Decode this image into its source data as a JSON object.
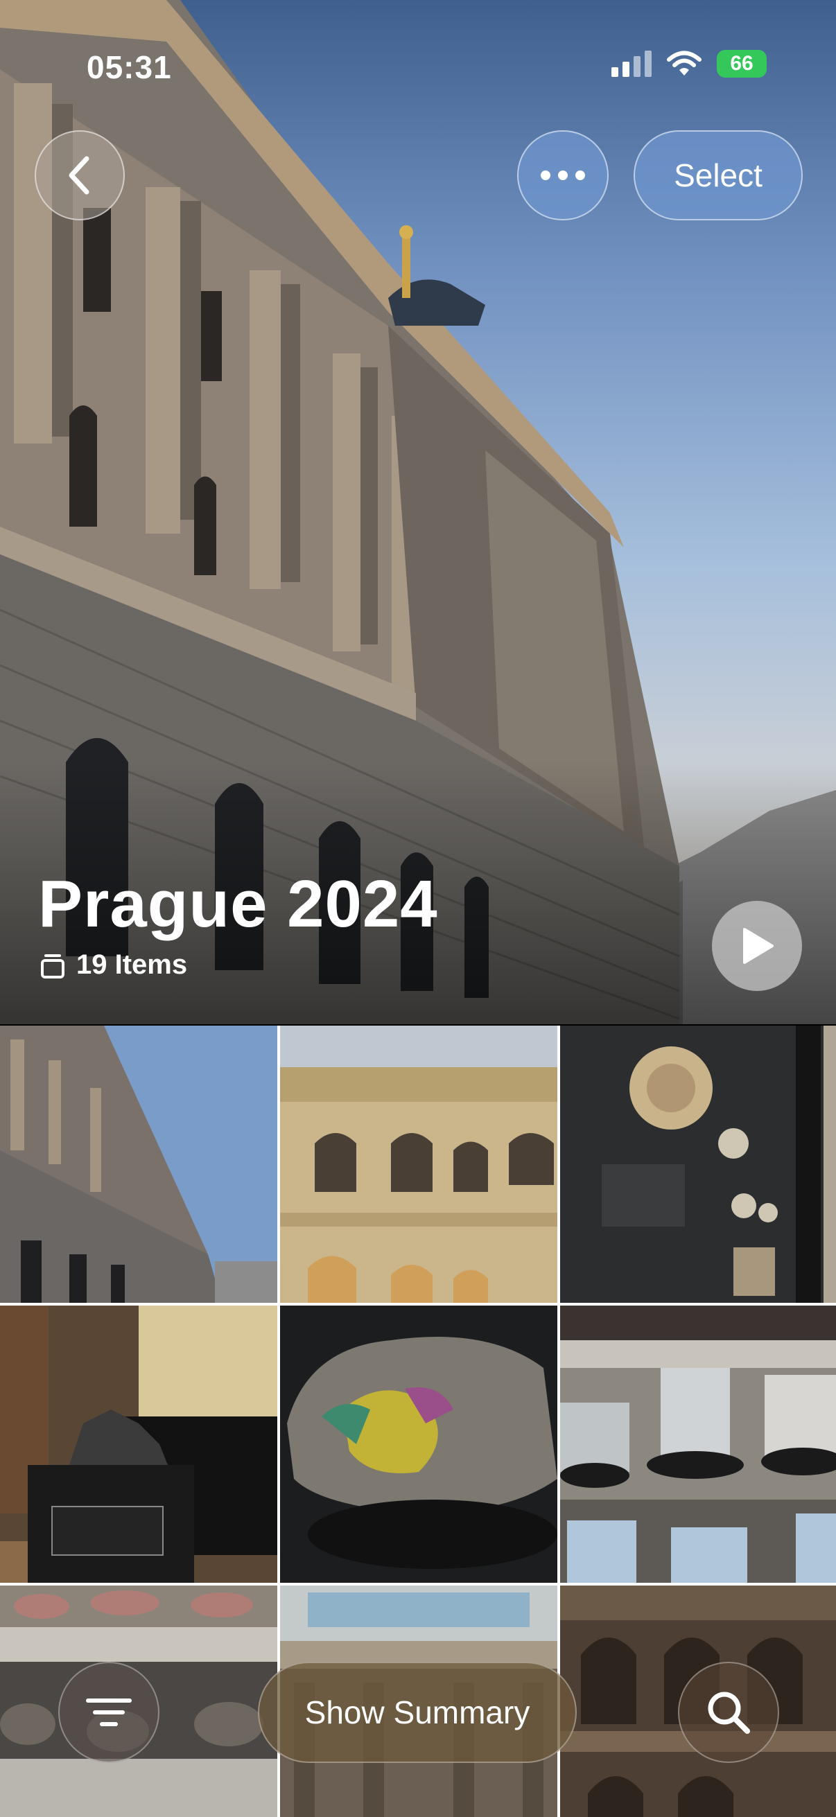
{
  "status": {
    "time": "05:31",
    "battery": "66"
  },
  "header": {
    "select_label": "Select"
  },
  "album": {
    "title": "Prague 2024",
    "count": "19 Items"
  },
  "toolbar": {
    "summary_label": "Show Summary"
  },
  "icons": {
    "back": "chevron-left-icon",
    "more": "ellipsis-icon",
    "play": "play-icon",
    "stack": "stack-icon",
    "filter": "filter-lines-icon",
    "search": "magnifier-icon"
  },
  "colors": {
    "battery": "#34c759",
    "glass_blue": "#6e96cd"
  }
}
